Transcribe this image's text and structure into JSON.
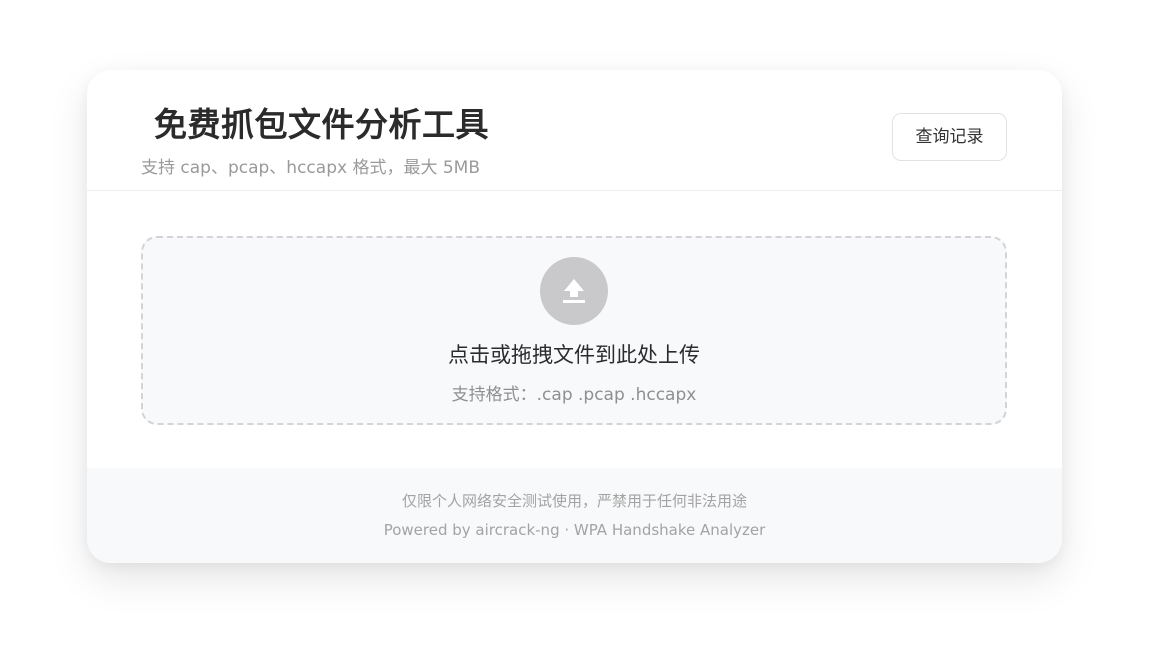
{
  "header": {
    "title": "免费抓包文件分析工具",
    "subtitle": "支持 cap、pcap、hccapx 格式，最大 5MB",
    "history_button": "查询记录"
  },
  "upload": {
    "icon": "upload-icon",
    "prompt": "点击或拖拽文件到此处上传",
    "formats": "支持格式：.cap .pcap .hccapx"
  },
  "footer": {
    "disclaimer": "仅限个人网络安全测试使用，严禁用于任何非法用途",
    "powered_by": "Powered by aircrack-ng · WPA Handshake Analyzer"
  },
  "colors": {
    "title": "#2b2b2b",
    "muted": "#9a9a9a",
    "icon_bg": "#c9c9cc",
    "dropzone_bg": "#f8f9fb",
    "dropzone_border": "#d3d3d8"
  }
}
